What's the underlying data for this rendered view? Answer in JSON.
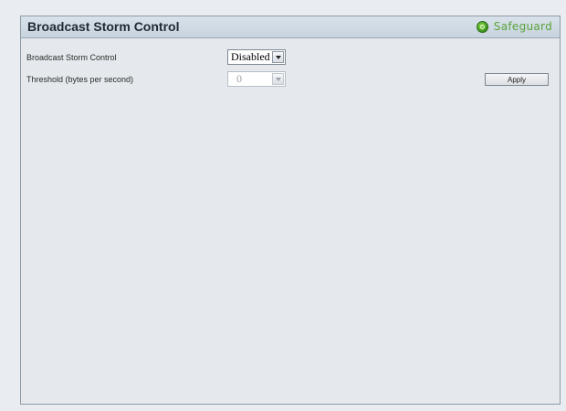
{
  "panel": {
    "title": "Broadcast Storm Control",
    "safeguard_label": "Safeguard"
  },
  "form": {
    "storm_control": {
      "label": "Broadcast Storm Control",
      "value": "Disabled"
    },
    "threshold": {
      "label": "Threshold  (bytes per second)",
      "value": "0"
    },
    "apply_label": "Apply"
  },
  "icons": {
    "safeguard": "status-dot-icon",
    "dropdown": "chevron-down-icon"
  },
  "colors": {
    "safeguard_green": "#5aa33a",
    "header_bg": "#c7d3de"
  }
}
